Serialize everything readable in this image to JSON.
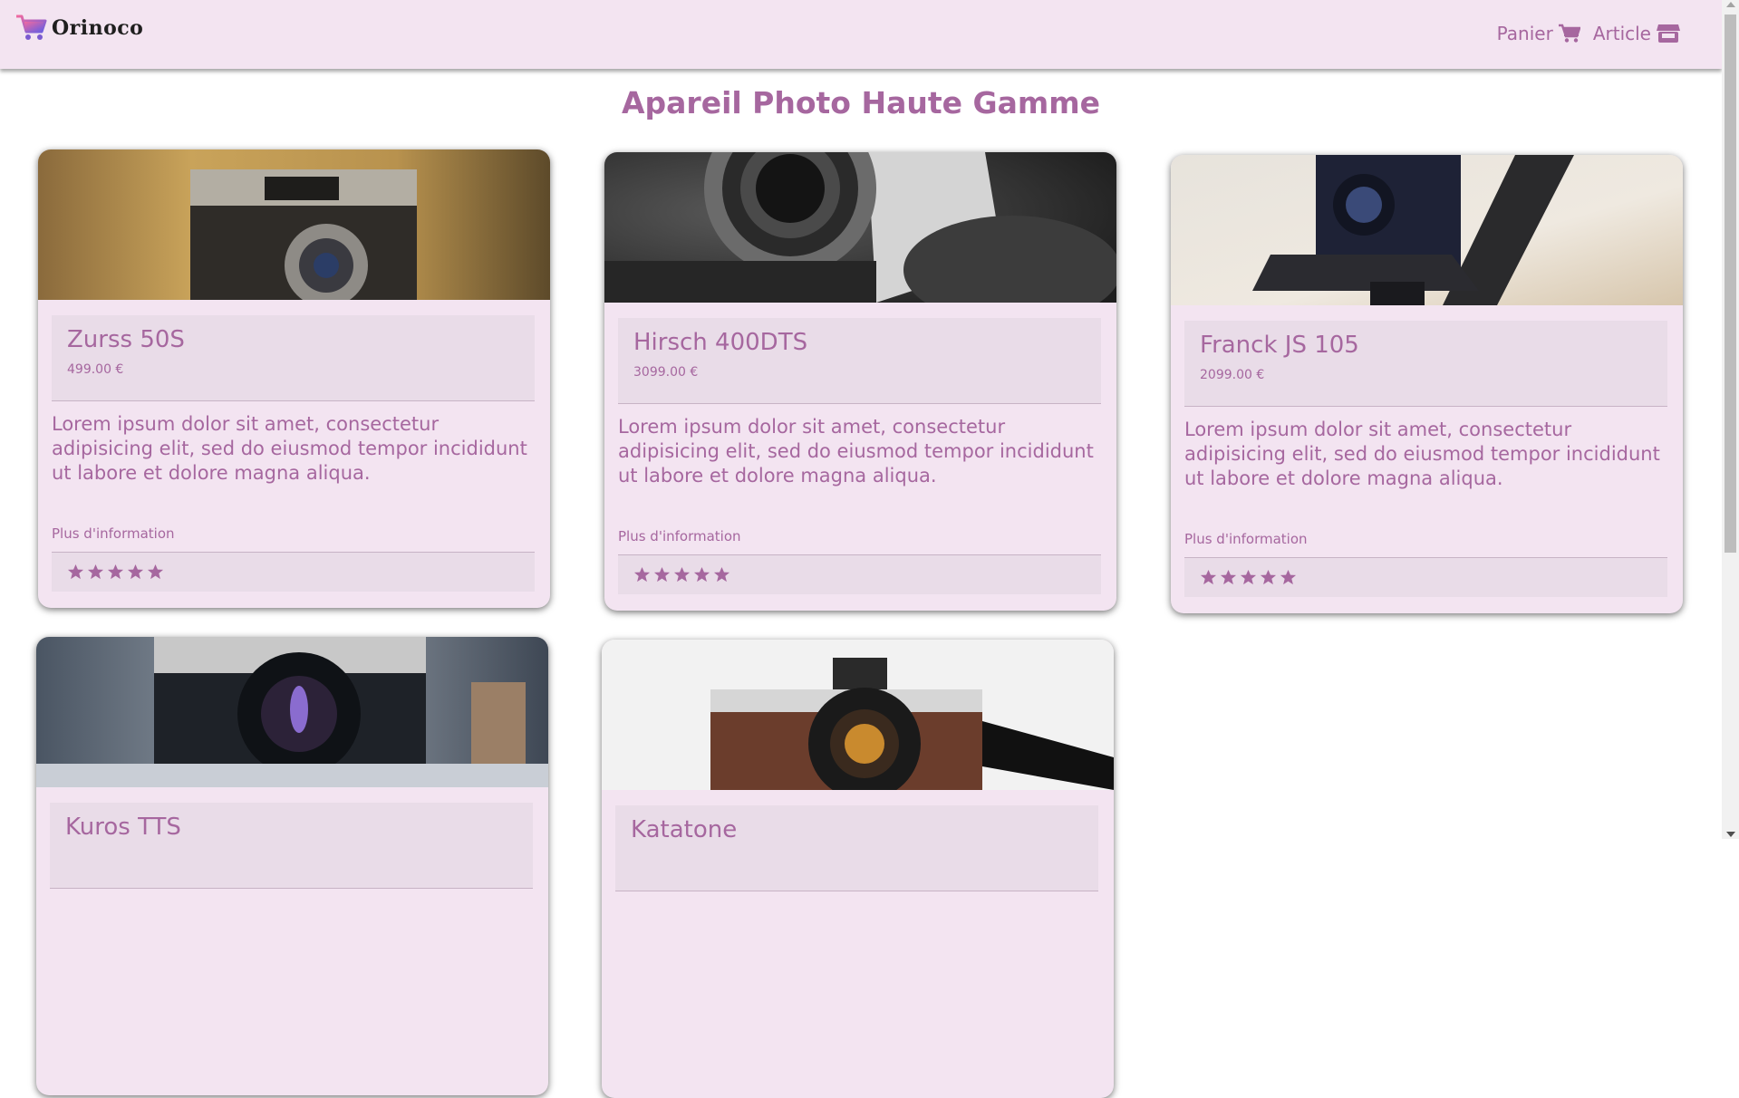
{
  "header": {
    "brand": "Orinoco",
    "nav": [
      {
        "label": "Panier",
        "icon": "cart-icon"
      },
      {
        "label": "Article",
        "icon": "store-icon"
      }
    ]
  },
  "page_title": "Apareil Photo Haute Gamme",
  "products": [
    {
      "name": "Zurss 50S",
      "price": "499.00 €",
      "description": "Lorem ipsum dolor sit amet, consectetur adipisicing elit, sed do eiusmod tempor incididunt ut labore et dolore magna aliqua.",
      "more": "Plus d'information",
      "rating": 5
    },
    {
      "name": "Hirsch 400DTS",
      "price": "3099.00 €",
      "description": "Lorem ipsum dolor sit amet, consectetur adipisicing elit, sed do eiusmod tempor incididunt ut labore et dolore magna aliqua.",
      "more": "Plus d'information",
      "rating": 5
    },
    {
      "name": "Franck JS 105",
      "price": "2099.00 €",
      "description": "Lorem ipsum dolor sit amet, consectetur adipisicing elit, sed do eiusmod tempor incididunt ut labore et dolore magna aliqua.",
      "more": "Plus d'information",
      "rating": 5
    },
    {
      "name": "Kuros TTS"
    },
    {
      "name": "Katatone"
    }
  ],
  "colors": {
    "accent": "#a6679f",
    "navbar_bg": "#f3e4f1",
    "card_bg": "#f3e4f1",
    "card_section_bg": "#e9dce8"
  }
}
